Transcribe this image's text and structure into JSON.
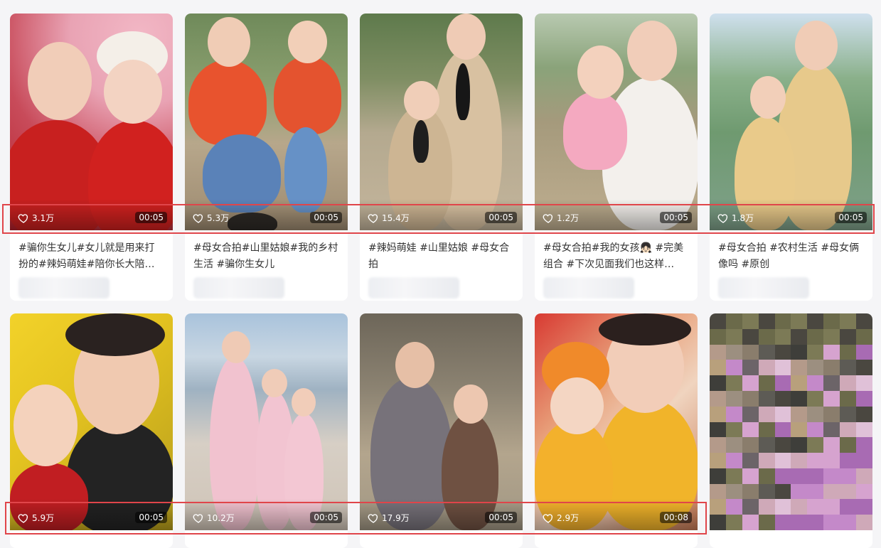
{
  "cards": [
    {
      "likes": "3.1万",
      "duration": "00:05",
      "desc": "#骗你生女儿#女儿就是用来打扮的#辣妈萌娃#陪你长大陪…"
    },
    {
      "likes": "5.3万",
      "duration": "00:05",
      "desc": "#母女合拍#山里姑娘#我的乡村生活 #骗你生女儿"
    },
    {
      "likes": "15.4万",
      "duration": "00:05",
      "desc": "#辣妈萌娃 #山里姑娘 #母女合拍"
    },
    {
      "likes": "1.2万",
      "duration": "00:05",
      "desc": "#母女合拍#我的女孩👧🏻 #完美组合 #下次见面我们也这样…"
    },
    {
      "likes": "1.8万",
      "duration": "00:05",
      "desc": "#母女合拍 #农村生活 #母女俩像吗 #原创"
    },
    {
      "likes": "5.9万",
      "duration": "00:05"
    },
    {
      "likes": "10.2万",
      "duration": "00:05"
    },
    {
      "likes": "17.9万",
      "duration": "00:05"
    },
    {
      "likes": "2.9万",
      "duration": "00:08"
    },
    {
      "likes": "",
      "duration": ""
    }
  ],
  "colors": {
    "highlight": "#e0454a",
    "card_bg": "#ffffff",
    "page_bg": "#f5f5f7"
  },
  "icons": {
    "like": "heart-outline-icon"
  }
}
